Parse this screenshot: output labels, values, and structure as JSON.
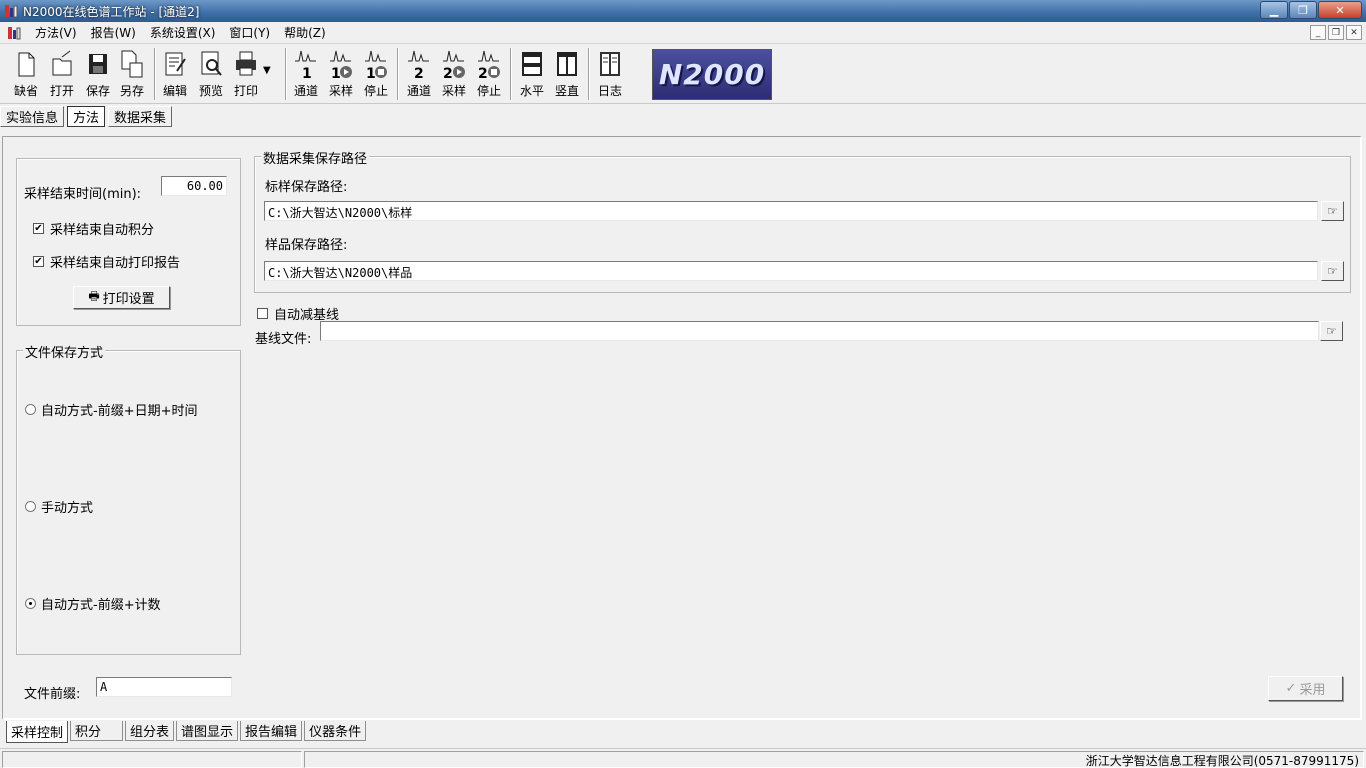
{
  "window": {
    "title": "N2000在线色谱工作站 - [通道2]"
  },
  "menu": {
    "items": [
      "方法(V)",
      "报告(W)",
      "系统设置(X)",
      "窗口(Y)",
      "帮助(Z)"
    ]
  },
  "toolbar": {
    "new": "缺省",
    "open": "打开",
    "save": "保存",
    "save_as": "另存",
    "edit": "编辑",
    "preview": "预览",
    "print": "打印",
    "ch1_channel": "通道",
    "ch1_sample": "采样",
    "ch1_stop": "停止",
    "ch2_channel": "通道",
    "ch2_sample": "采样",
    "ch2_stop": "停止",
    "horizontal": "水平",
    "vertical": "竖直",
    "log": "日志",
    "logo_text": "N2000"
  },
  "top_tabs": [
    "实验信息",
    "方法",
    "数据采集"
  ],
  "sampling": {
    "end_time_label": "采样结束时间(min):",
    "end_time_value": "60.00",
    "auto_integrate_label": "采样结束自动积分",
    "auto_integrate_checked": true,
    "auto_print_label": "采样结束自动打印报告",
    "auto_print_checked": true,
    "print_setup_button": "打印设置"
  },
  "file_save": {
    "title": "文件保存方式",
    "option_date": "自动方式-前缀+日期+时间",
    "option_manual": "手动方式",
    "option_count": "自动方式-前缀+计数",
    "selected": "option_count",
    "prefix_label": "文件前缀:",
    "prefix_value": "A"
  },
  "paths": {
    "title": "数据采集保存路径",
    "standard_label": "标样保存路径:",
    "standard_value": "C:\\浙大智达\\N2000\\标样",
    "sample_label": "样品保存路径:",
    "sample_value": "C:\\浙大智达\\N2000\\样品"
  },
  "baseline": {
    "auto_subtract_label": "自动减基线",
    "auto_subtract_checked": false,
    "file_label": "基线文件:",
    "file_value": ""
  },
  "apply_button": "采用",
  "bottom_tabs": [
    "采样控制",
    "积分",
    "组分表",
    "谱图显示",
    "报告编辑",
    "仪器条件"
  ],
  "status": {
    "company": "浙江大学智达信息工程有限公司(0571-87991175)"
  }
}
